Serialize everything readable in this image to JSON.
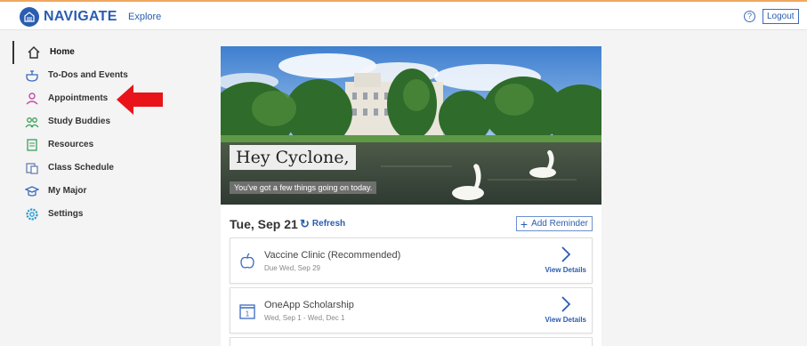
{
  "app": {
    "name": "NAVIGATE",
    "explore_label": "Explore",
    "help_label": "?",
    "logout_label": "Logout"
  },
  "sidebar": {
    "items": [
      {
        "label": "Home",
        "icon": "home-icon"
      },
      {
        "label": "To-Dos and Events",
        "icon": "todo-icon"
      },
      {
        "label": "Appointments",
        "icon": "person-icon"
      },
      {
        "label": "Study Buddies",
        "icon": "study-buddies-icon"
      },
      {
        "label": "Resources",
        "icon": "resources-icon"
      },
      {
        "label": "Class Schedule",
        "icon": "class-schedule-icon"
      },
      {
        "label": "My Major",
        "icon": "graduation-cap-icon"
      },
      {
        "label": "Settings",
        "icon": "gear-icon"
      }
    ],
    "active": "Home"
  },
  "hero": {
    "title": "Hey Cyclone,",
    "subtitle": "You've got a few things going on today."
  },
  "day": {
    "date": "Tue, Sep 21",
    "refresh_label": "Refresh",
    "add_reminder_label": "Add Reminder"
  },
  "events": [
    {
      "title": "Vaccine Clinic (Recommended)",
      "date": "Due Wed, Sep 29",
      "action": "View Details",
      "icon": "apple-icon"
    },
    {
      "title": "OneApp Scholarship",
      "date": "Wed, Sep 1 - Wed, Dec 1",
      "action": "View Details",
      "icon": "calendar-icon"
    }
  ],
  "colors": {
    "brand": "#2a5db0",
    "arrow": "#e02020",
    "accent_line": "#f0a860"
  }
}
